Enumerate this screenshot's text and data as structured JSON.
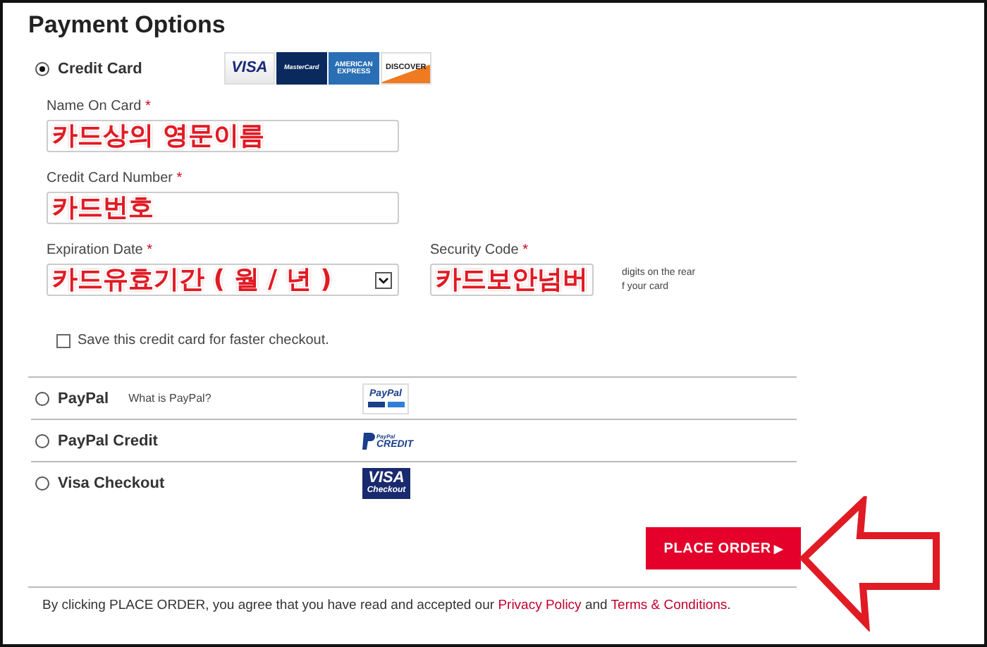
{
  "title": "Payment Options",
  "credit_card": {
    "label": "Credit Card",
    "selected": true,
    "logos": [
      {
        "kind": "visa",
        "text": "VISA"
      },
      {
        "kind": "mastercard",
        "text": "MasterCard"
      },
      {
        "kind": "amex",
        "text": "AMERICAN EXPRESS"
      },
      {
        "kind": "discover",
        "text": "DISCOVER"
      }
    ],
    "name": {
      "label": "Name On Card",
      "asterisk": "*",
      "value": "카드상의 영문이름"
    },
    "number": {
      "label": "Credit Card Number",
      "asterisk": "*",
      "value": "카드번호"
    },
    "expiration": {
      "label": "Expiration Date",
      "asterisk": "*",
      "value": "카드유효기간 ( 월 / 년 )"
    },
    "security": {
      "label": "Security Code",
      "asterisk": "*",
      "value": "카드보안넘버",
      "hint": [
        "digits on the rear",
        "f your card"
      ]
    },
    "save": {
      "label": "Save this credit card for faster checkout.",
      "checked": false
    }
  },
  "other_methods": [
    {
      "kind": "paypal",
      "label": "PayPal",
      "link": "What is PayPal?",
      "selected": false,
      "logo": [
        "PayPal"
      ]
    },
    {
      "kind": "paypal_credit",
      "label": "PayPal Credit",
      "selected": false,
      "logo": [
        "PayPal",
        "CREDIT"
      ]
    },
    {
      "kind": "visa_checkout",
      "label": "Visa Checkout",
      "selected": false,
      "logo": [
        "VISA",
        "Checkout"
      ]
    }
  ],
  "place_order": {
    "label": "PLACE ORDER",
    "arrow": "▶"
  },
  "footer": {
    "text": "By clicking PLACE ORDER, you agree that you have read and accepted our",
    "link1": "Privacy Policy",
    "and": "and",
    "link2": "Terms & Conditions",
    "end": "."
  }
}
